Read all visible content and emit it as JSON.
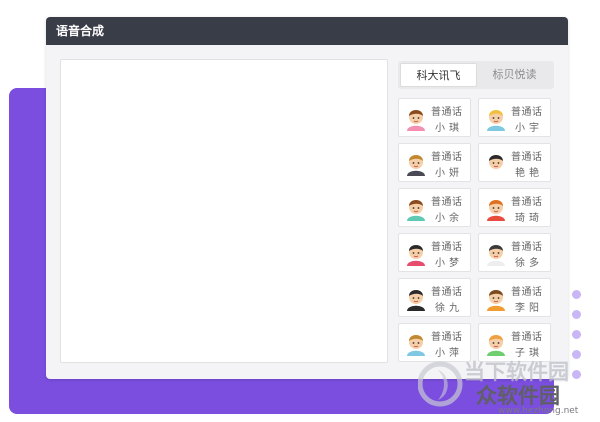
{
  "window": {
    "title": "语音合成"
  },
  "editor": {
    "value": ""
  },
  "tabs": [
    {
      "label": "科大讯飞",
      "active": true
    },
    {
      "label": "标贝悦读",
      "active": false
    }
  ],
  "voices": [
    {
      "lang": "普通话",
      "name": "小琪",
      "icon": "girl-avatar-icon"
    },
    {
      "lang": "普通话",
      "name": "小宇",
      "icon": "boy-avatar-icon"
    },
    {
      "lang": "普通话",
      "name": "小妍",
      "icon": "woman-avatar-icon"
    },
    {
      "lang": "普通话",
      "name": "艳艳",
      "icon": "woman-avatar-icon"
    },
    {
      "lang": "普通话",
      "name": "小余",
      "icon": "boy-avatar-icon"
    },
    {
      "lang": "普通话",
      "name": "琦琦",
      "icon": "girl-avatar-icon"
    },
    {
      "lang": "普通话",
      "name": "小梦",
      "icon": "girl-avatar-icon"
    },
    {
      "lang": "普通话",
      "name": "徐多",
      "icon": "man-avatar-icon"
    },
    {
      "lang": "普通话",
      "name": "徐九",
      "icon": "man-avatar-icon"
    },
    {
      "lang": "普通话",
      "name": "李阳",
      "icon": "boy-avatar-icon"
    },
    {
      "lang": "普通话",
      "name": "小萍",
      "icon": "girl-avatar-icon"
    },
    {
      "lang": "普通话",
      "name": "子琪",
      "icon": "girl-avatar-icon"
    }
  ],
  "watermark": {
    "line1": "当下软件园",
    "line2": "众软件园",
    "url": "www.hezhong.net"
  },
  "colors": {
    "accent": "#7b4ee0",
    "titlebar": "#393d48"
  }
}
